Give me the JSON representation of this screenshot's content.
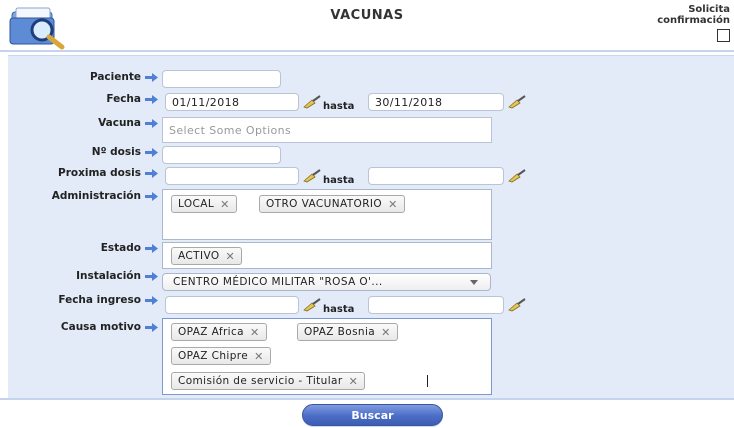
{
  "header": {
    "title": "VACUNAS",
    "confirm_label_1": "Solicita",
    "confirm_label_2": "confirmación"
  },
  "form": {
    "paciente": {
      "label": "Paciente",
      "value": ""
    },
    "fecha": {
      "label": "Fecha",
      "from": "01/11/2018",
      "hasta": "hasta",
      "to": "30/11/2018"
    },
    "vacuna": {
      "label": "Vacuna",
      "placeholder": "Select Some Options"
    },
    "n_dosis": {
      "label": "Nº dosis",
      "value": ""
    },
    "proxima_dosis": {
      "label": "Proxima dosis",
      "from": "",
      "hasta": "hasta",
      "to": ""
    },
    "administracion": {
      "label": "Administración",
      "chips": [
        "LOCAL",
        "OTRO VACUNATORIO"
      ]
    },
    "estado": {
      "label": "Estado",
      "chips": [
        "ACTIVO"
      ]
    },
    "instalacion": {
      "label": "Instalación",
      "selected": "CENTRO MÉDICO MILITAR \"ROSA O'..."
    },
    "fecha_ingreso": {
      "label": "Fecha ingreso",
      "from": "",
      "hasta": "hasta",
      "to": ""
    },
    "causa_motivo": {
      "label": "Causa motivo",
      "chips": [
        "OPAZ Africa",
        "OPAZ Bosnia",
        "OPAZ Chipre",
        "Comisión de servicio - Titular"
      ]
    }
  },
  "buttons": {
    "search_label": "Buscar"
  },
  "icons": {
    "logo": "search-folder-icon",
    "row_arrow": "arrow-right-icon",
    "date_picker": "broom-icon",
    "remove": "close-icon"
  },
  "colors": {
    "panel_bg": "#e3ebf8",
    "button": "#4c6dc6"
  }
}
